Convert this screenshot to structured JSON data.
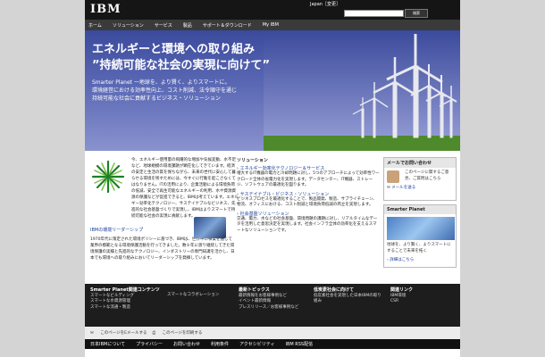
{
  "header": {
    "logo": "IBM",
    "country": "Japan［変更］",
    "search": {
      "placeholder": "",
      "button": "検索"
    }
  },
  "nav": {
    "items": [
      "ホーム",
      "ソリューション",
      "サービス",
      "製品",
      "サポート＆ダウンロード",
      "My IBM"
    ]
  },
  "hero": {
    "title1": "エネルギーと環境への取り組み",
    "title2": "”持続可能な社会の実現に向けて”",
    "sub_lines": [
      "Smarter Planet 一地球を、より賢く、よりスマートに。",
      "環境経営における効率性向上、コスト削減、法令順守を通じ",
      "持続可能な社会に貢献するビジネス・ソリューション"
    ]
  },
  "intro": {
    "text": "今、エネルギー使用量の飛躍的な増加や気候変動、水不足など、地球規模の環境課題が顕在化してきています。経済の安定と生活の質を保ちながら、未来の世代に安心して暮らせる環境を残すためには、今すぐに行動を起こさなくてはなりません。ITの活用により、企業活動による環境負荷の低減、安全で再生可能なエネルギーの利用、水や資源資源の保護などが促進できると、IBMは考えています。エネルギー効率化テクノロジー、サステイナブルなビジネス、先進的な社会基盤づくりで実現し、IBMはよりスマートで持続可能な社会の実現に貢献します。",
    "link": "IBMの環境リーダーシップ",
    "body": "1970年代に策定された環境ポリシーに基づき、IBMは、世界中の事業を通じて業界の模範となる環境保護活動を行ってきました。数十年に渡り継続してきた環境保護の実績と先進的なテクノロジー、インダストリーの専門知識を活かし、日本でも環境への取り組みにおいてリーダーシップを発揮しています。"
  },
  "solutions": {
    "title": "ソリューション",
    "items": [
      {
        "link": "エネルギー効率化テクノロジー＆サービス",
        "text": "増大するIT機器の電力と冷却問題に対し、5つのアプローチによって効率性ワークロード全体の省電力化を実現します。データセンター、IT機器、ストレージ、ソフトウェアの最適化を図ります。"
      },
      {
        "link": "サステイナブル・ビジネス・ソリューション",
        "text": "ビジネスプロセスを最適化することで、製品開発、製造、サプライチェーン、物流、オフィスにおける、コスト削減と環境負荷低減の両立を実現します。"
      },
      {
        "link": "社会基盤ソリューション",
        "text": "交通、電力、水などの社会基盤、環境問題の課題に対し、リアルタイムなデータを活用した意思決定を実現します。社会インフラ全体の効率化を支えるスマートなソリューションです。"
      }
    ]
  },
  "sidebar": {
    "contact": {
      "title": "メールでお問い合わせ",
      "text": "このページに関するご意見、ご質問はこちら",
      "link": "メールを送る"
    },
    "smarter": {
      "title": "Smarter Planet",
      "text": "地球を、より賢く、よりスマートにすることで未来を拓く",
      "link": "詳細はこちら"
    }
  },
  "footer": {
    "columns": [
      {
        "title": "Smarter Planet関連コンテンツ",
        "items": [
          "スマートなビルディング",
          "スマートな水資源管理",
          "スマートな流通・製造"
        ]
      },
      {
        "title": "",
        "items": [
          "スマートなコラボレーション"
        ]
      },
      {
        "title": "最新トピックス",
        "items": [
          "最新情報をお客様事例など",
          "イベント最新情報",
          "プレスリリース／お客様事例など"
        ]
      },
      {
        "title": "低炭素社会に向けて",
        "items": [
          "低炭素社会を実現した日本IBMの取り組み"
        ]
      },
      {
        "title": "関連リンク",
        "items": [
          "IBM環境",
          "CSR"
        ]
      }
    ],
    "util": [
      "このページをEメールする",
      "このページを印刷する"
    ],
    "legal": [
      "日本IBMについて",
      "プライバシー",
      "お問い合わせ",
      "利用条件",
      "アクセシビリティ",
      "IBM RSS配信"
    ]
  }
}
